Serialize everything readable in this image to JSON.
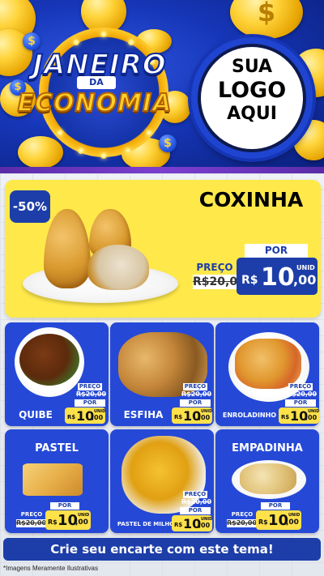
{
  "header": {
    "title_line1": "JANEIRO",
    "title_line2": "DA",
    "title_line3": "ECONOMIA",
    "logo_line1": "SUA",
    "logo_line2": "LOGO",
    "logo_line3": "AQUI",
    "coin_symbol": "$"
  },
  "featured": {
    "name": "COXINHA",
    "discount": "-50%",
    "preco_label": "PREÇO",
    "old_price": "R$20,00",
    "por_label": "POR",
    "currency": "R$",
    "price_int": "10",
    "price_cents": ",00",
    "unit": "UNID"
  },
  "products": [
    {
      "name": "QUIBE",
      "preco_label": "PREÇO",
      "old_price": "R$20,00",
      "por_label": "POR",
      "currency": "R$",
      "price_int": "10",
      "price_cents": ",00",
      "unit": "UNID"
    },
    {
      "name": "ESFIHA",
      "preco_label": "PREÇO",
      "old_price": "R$20,00",
      "por_label": "POR",
      "currency": "R$",
      "price_int": "10",
      "price_cents": ",00",
      "unit": "UNID"
    },
    {
      "name": "ENROLADINHO",
      "preco_label": "PREÇO",
      "old_price": "R$20,00",
      "por_label": "POR",
      "currency": "R$",
      "price_int": "10",
      "price_cents": ",00",
      "unit": "UNID"
    },
    {
      "name": "PASTEL",
      "preco_label": "PREÇO",
      "old_price": "R$20,00",
      "por_label": "POR",
      "currency": "R$",
      "price_int": "10",
      "price_cents": ",00",
      "unit": "UNID"
    },
    {
      "name": "PASTEL DE MILHO",
      "preco_label": "PREÇO",
      "old_price": "R$20,00",
      "por_label": "POR",
      "currency": "R$",
      "price_int": "10",
      "price_cents": ",00",
      "unit": "UNID"
    },
    {
      "name": "EMPADINHA",
      "preco_label": "PREÇO",
      "old_price": "R$20,00",
      "por_label": "POR",
      "currency": "R$",
      "price_int": "10",
      "price_cents": ",00",
      "unit": "UNID"
    }
  ],
  "footer": {
    "cta": "Crie seu encarte com este tema!",
    "disclaimer": "*Imagens Meramente Ilustrativas"
  },
  "colors": {
    "primary_blue": "#1d3ea8",
    "card_blue": "#2549d6",
    "featured_yellow": "#ffe94a",
    "price_yellow": "#ffe14a",
    "coin_gold": "#ffd43b"
  }
}
